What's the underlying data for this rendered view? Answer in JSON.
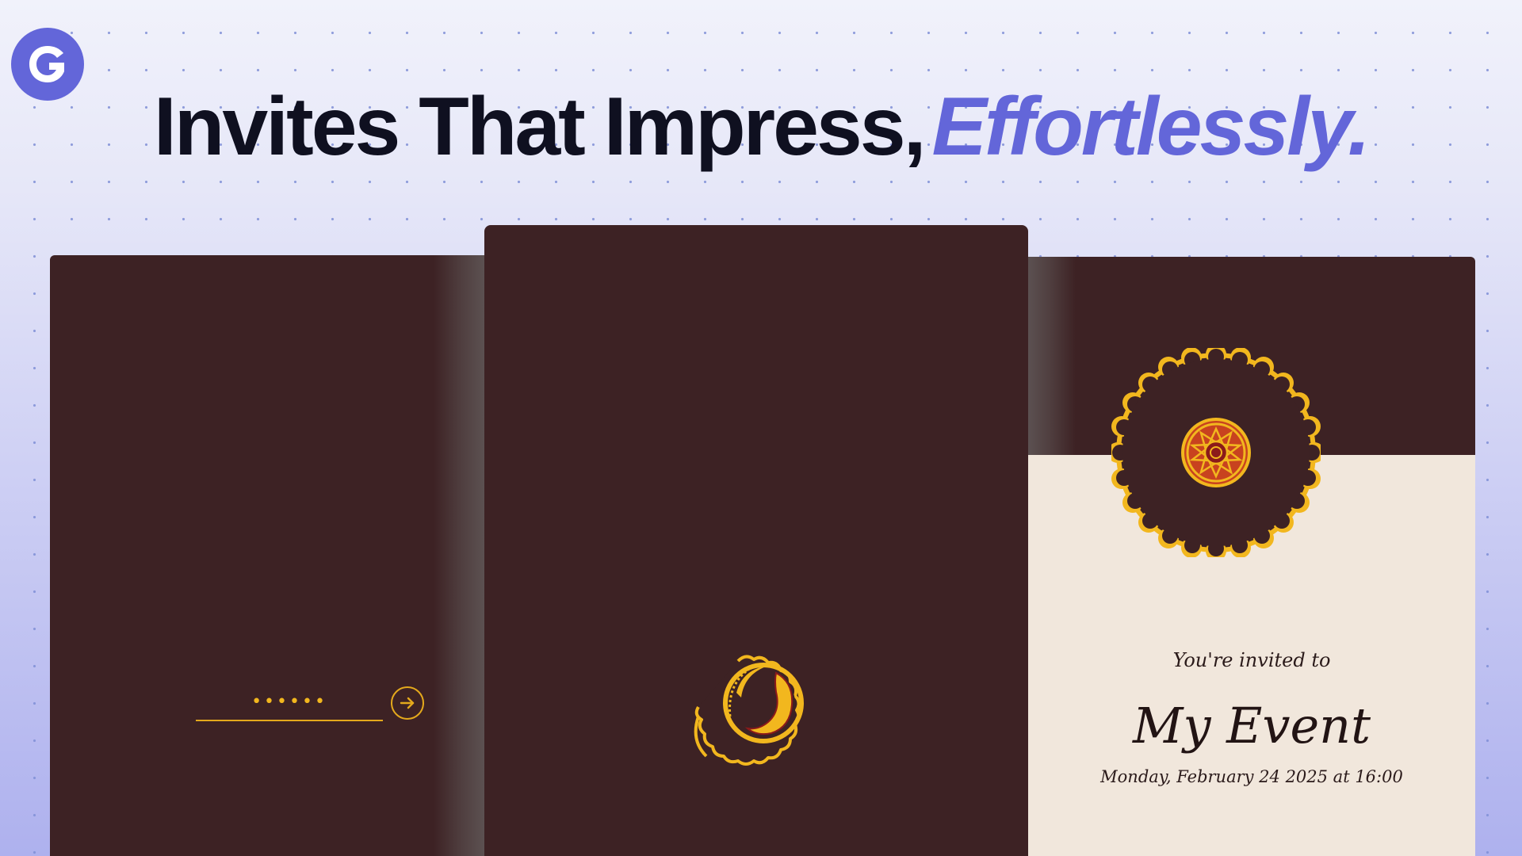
{
  "header": {
    "logo_letter": "G",
    "headline_main": "Invites That Impress,",
    "headline_accent": "Effortlessly."
  },
  "left_panel": {
    "password_placeholder": "••••••"
  },
  "right_panel": {
    "invited_text": "You're invited to",
    "event_title": "My Event",
    "event_date": "Monday, February 24 2025 at 16:00"
  },
  "colors": {
    "accent": "#6366d9",
    "panel_bg": "#3d2224",
    "gold": "#f2b71e",
    "cream": "#f1e7dc",
    "seal_red": "#8b1a1a"
  },
  "icons": {
    "logo": "logo-icon",
    "submit": "arrow-right-icon",
    "seal": "seal-icon"
  }
}
